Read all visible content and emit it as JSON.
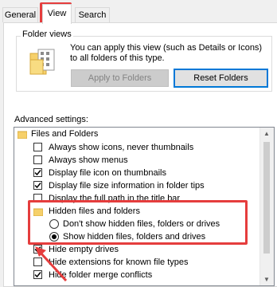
{
  "tabs": [
    {
      "label": "General",
      "active": false
    },
    {
      "label": "View",
      "active": true
    },
    {
      "label": "Search",
      "active": false
    }
  ],
  "folder_views": {
    "title": "Folder views",
    "description": "You can apply this view (such as Details or Icons) to all folders of this type.",
    "apply_button": "Apply to Folders",
    "reset_button": "Reset Folders"
  },
  "advanced": {
    "label": "Advanced settings:",
    "items": [
      {
        "type": "folder",
        "label": "Files and Folders"
      },
      {
        "type": "checkbox",
        "label": "Always show icons, never thumbnails",
        "checked": false
      },
      {
        "type": "checkbox",
        "label": "Always show menus",
        "checked": false
      },
      {
        "type": "checkbox",
        "label": "Display file icon on thumbnails",
        "checked": true
      },
      {
        "type": "checkbox",
        "label": "Display file size information in folder tips",
        "checked": true
      },
      {
        "type": "checkbox",
        "label": "Display the full path in the title bar",
        "checked": false
      },
      {
        "type": "folder",
        "label": "Hidden files and folders"
      },
      {
        "type": "radio",
        "label": "Don't show hidden files, folders or drives",
        "selected": false
      },
      {
        "type": "radio",
        "label": "Show hidden files, folders and drives",
        "selected": true
      },
      {
        "type": "checkbox",
        "label": "Hide empty drives",
        "checked": true
      },
      {
        "type": "checkbox",
        "label": "Hide extensions for known file types",
        "checked": false
      },
      {
        "type": "checkbox",
        "label": "Hide folder merge conflicts",
        "checked": true
      }
    ]
  },
  "colors": {
    "highlight": "#e53d3d",
    "accent": "#0078d7"
  }
}
